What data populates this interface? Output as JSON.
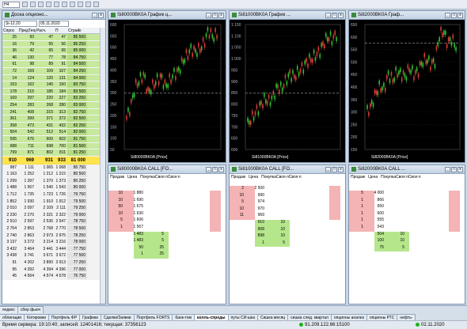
{
  "toolbar": {
    "selector": "H4"
  },
  "orderbook": {
    "title": "Доска опционо...",
    "base": "Si-12.20",
    "date": "05.11.2020",
    "headers": [
      "Спрос",
      "ПредТеор. цена",
      "Расч.",
      "П",
      "Страйк",
      ""
    ],
    "rows": [
      [
        "25",
        "50",
        "47",
        "47",
        "85 500"
      ],
      [
        "16",
        "79",
        "55",
        "56",
        "85 250"
      ],
      [
        "36",
        "42",
        "65",
        "65",
        "85 000"
      ],
      [
        "46",
        "130",
        "77",
        "78",
        "84 750"
      ],
      [
        "61",
        "98",
        "89",
        "91",
        "84 500"
      ],
      [
        "72",
        "169",
        "109",
        "107",
        "84 250"
      ],
      [
        "14",
        "124",
        "120",
        "131",
        "84 000"
      ],
      [
        "153",
        "162",
        "140",
        "150",
        "83 750"
      ],
      [
        "178",
        "215",
        "185",
        "184",
        "83 500"
      ],
      [
        "169",
        "297",
        "220",
        "227",
        "83 250"
      ],
      [
        "254",
        "283",
        "268",
        "280",
        "83 000"
      ],
      [
        "241",
        "408",
        "315",
        "313",
        "82 750"
      ],
      [
        "361",
        "399",
        "371",
        "372",
        "82 500"
      ],
      [
        "358",
        "473",
        "431",
        "432",
        "82 250"
      ],
      [
        "504",
        "542",
        "512",
        "514",
        "82 000"
      ],
      [
        "595",
        "676",
        "600",
        "602",
        "81 750"
      ],
      [
        "688",
        "711",
        "698",
        "700",
        "81 500"
      ],
      [
        "799",
        "871",
        "802",
        "811",
        "81 250"
      ],
      [
        "910",
        "969",
        "931",
        "933",
        "81 000"
      ],
      [
        "987",
        "1 111",
        "1 065",
        "1 068",
        "80 750"
      ],
      [
        "1 163",
        "1 252",
        "1 212",
        "1 215",
        "80 500"
      ],
      [
        "1 299",
        "1 397",
        "1 370",
        "1 373",
        "80 250"
      ],
      [
        "1 488",
        "1 567",
        "1 540",
        "1 543",
        "80 000"
      ],
      [
        "1 712",
        "1 735",
        "1 723",
        "1 726",
        "79 750"
      ],
      [
        "1 852",
        "1 930",
        "1 910",
        "1 912",
        "79 500"
      ],
      [
        "2 010",
        "2 097",
        "2 109",
        "2 111",
        "79 250"
      ],
      [
        "2 230",
        "2 270",
        "2 321",
        "2 322",
        "79 000"
      ],
      [
        "2 510",
        "2 597",
        "2 536",
        "2 547",
        "78 750"
      ],
      [
        "2 704",
        "2 853",
        "2 768",
        "2 770",
        "78 500"
      ],
      [
        "2 740",
        "2 863",
        "2 973",
        "2 975",
        "78 250"
      ],
      [
        "3 137",
        "3 272",
        "3 214",
        "3 216",
        "78 000"
      ],
      [
        "3 432",
        "3 464",
        "3 441",
        "3 444",
        "77 750"
      ],
      [
        "3 438",
        "3 741",
        "3 671",
        "3 672",
        "77 500"
      ],
      [
        "91",
        "4 202",
        "3 890",
        "3 913",
        "77 250"
      ],
      [
        "95",
        "4 392",
        "4 394",
        "4 396",
        "77 000"
      ],
      [
        "45",
        "4 564",
        "4 574",
        "4 578",
        "76 750"
      ]
    ],
    "mid_index": 18
  },
  "charts": [
    {
      "title": "Si80000BK0A График ц...",
      "legend": "Si80000BK0A [Price]",
      "yticks": [
        "600",
        "550",
        "500",
        "450",
        "400",
        "350",
        "300",
        "250",
        "200",
        "150",
        "100",
        "50"
      ]
    },
    {
      "title": "Si81000BK0A График ...",
      "legend": "Si81000BK0A [Price]",
      "yticks": [
        "1 150",
        "1 100",
        "1 050",
        "1 000",
        "950",
        "900",
        "850",
        "800",
        "750",
        "700",
        "650",
        "600"
      ]
    },
    {
      "title": "Si82000BK0A Граф...",
      "legend": "Si82000BK0A [Price]",
      "yticks": [
        "650",
        "600",
        "550",
        "500",
        "450",
        "400",
        "350",
        "300",
        "250",
        "200",
        "150"
      ]
    }
  ],
  "options": [
    {
      "title": "Si80000BK0A CALL [FO...",
      "headers": [
        "Продаж",
        "Цена",
        "ПокупкаСвоя пСвоя п"
      ],
      "asks": [
        [
          "10",
          "1 880"
        ],
        [
          "10",
          "1 690"
        ],
        [
          "50",
          "1 675"
        ],
        [
          "10",
          "1 630"
        ],
        [
          "5",
          "1 606"
        ],
        [
          "1",
          "1 567"
        ]
      ],
      "bids": [
        [
          "1 483",
          "5"
        ],
        [
          "1 483",
          "5"
        ],
        [
          "50",
          "25"
        ],
        [
          "1",
          "25"
        ]
      ]
    },
    {
      "title": "Si81000BK0A CALL [FO...",
      "headers": [
        "Продаж",
        "Цена",
        "ПокупкаСвоя пСвоя п"
      ],
      "asks": [
        [
          "2",
          "2 500"
        ],
        [
          "10",
          "990"
        ],
        [
          "5",
          "974"
        ],
        [
          "10",
          "970"
        ],
        [
          "11",
          "969"
        ]
      ],
      "bids": [
        [
          "910",
          "10"
        ],
        [
          "908",
          "10"
        ],
        [
          "898",
          "10"
        ],
        [
          "1",
          "5"
        ]
      ]
    },
    {
      "title": "Si82000BK0A CALL ...",
      "headers": [
        "Продаж",
        "Цена",
        "ПокупкаСвоя пСвоя п"
      ],
      "asks": [
        [
          "5",
          "4 000"
        ],
        [
          "1",
          "866"
        ],
        [
          "1",
          "650"
        ],
        [
          "1",
          "600"
        ],
        [
          "1",
          "555"
        ],
        [
          "1",
          "543"
        ]
      ],
      "bids": [
        [
          "504",
          "10"
        ],
        [
          "100",
          "10"
        ],
        [
          "75",
          "5"
        ]
      ]
    }
  ],
  "tabs_top": [
    "яндекс",
    "сбер фьюч"
  ],
  "tabs": [
    "облигации",
    "Котировки",
    "Портфель ФР",
    "Графики",
    "Сделки/Заявки",
    "Портфель FORTS",
    "банк-том",
    "колль-спреды",
    "путы СИ-шка",
    "Сишка месяц",
    "сишка след. квартал",
    "опционы анализ",
    "опционы РТС",
    "нефть-"
  ],
  "active_tab": 7,
  "status": {
    "server_time": "Время сервера: 19:10:40; записей: 12401416; текущая: 37356123",
    "connection": "91.209.122.66:15100",
    "date": "02.11.2020"
  }
}
